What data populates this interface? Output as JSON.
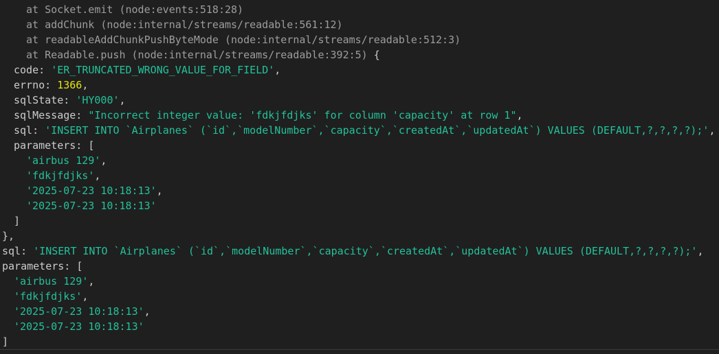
{
  "stack": [
    "at Socket.emit (node:events:518:28)",
    "at addChunk (node:internal/streams/readable:561:12)",
    "at readableAddChunkPushByteMode (node:internal/streams/readable:512:3)",
    "at Readable.push (node:internal/streams/readable:392:5)"
  ],
  "open_brace": " {",
  "error": {
    "code_key": "code: ",
    "code_val": "'ER_TRUNCATED_WRONG_VALUE_FOR_FIELD'",
    "errno_key": "errno: ",
    "errno_val": "1366",
    "sqlstate_key": "sqlState: ",
    "sqlstate_val": "'HY000'",
    "sqlmessage_key": "sqlMessage: ",
    "sqlmessage_val": "\"Incorrect integer value: 'fdkjfdjks' for column 'capacity' at row 1\"",
    "sql_key": "sql: ",
    "sql_val": "'INSERT INTO `Airplanes` (`id`,`modelNumber`,`capacity`,`createdAt`,`updatedAt`) VALUES (DEFAULT,?,?,?,?);'",
    "params_key": "parameters: ",
    "params": [
      "'airbus 129'",
      "'fdkjfdjks'",
      "'2025-07-23 10:18:13'",
      "'2025-07-23 10:18:13'"
    ]
  },
  "outer": {
    "sql_key": "sql: ",
    "sql_val": "'INSERT INTO `Airplanes` (`id`,`modelNumber`,`capacity`,`createdAt`,`updatedAt`) VALUES (DEFAULT,?,?,?,?);'",
    "params_key": "parameters: ",
    "params": [
      "'airbus 129'",
      "'fdkjfdjks'",
      "'2025-07-23 10:18:13'",
      "'2025-07-23 10:18:13'"
    ]
  },
  "punct": {
    "comma": ",",
    "open_bracket": "[",
    "close_bracket": "]",
    "close_brace_comma": "},"
  }
}
